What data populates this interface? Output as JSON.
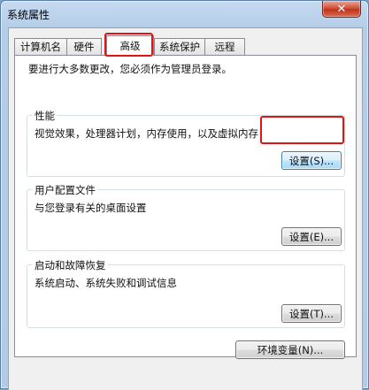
{
  "window": {
    "title": "系统属性",
    "close_symbol": "✕"
  },
  "tabs": [
    {
      "label": "计算机名"
    },
    {
      "label": "硬件"
    },
    {
      "label": "高级"
    },
    {
      "label": "系统保护"
    },
    {
      "label": "远程"
    }
  ],
  "panel": {
    "intro": "要进行大多数更改，您必须作为管理员登录。",
    "performance": {
      "title": "性能",
      "desc": "视觉效果，处理器计划，内存使用，以及虚拟内存",
      "button": "设置(S)..."
    },
    "user_profiles": {
      "title": "用户配置文件",
      "desc": "与您登录有关的桌面设置",
      "button": "设置(E)..."
    },
    "startup_recovery": {
      "title": "启动和故障恢复",
      "desc": "系统启动、系统失败和调试信息",
      "button": "设置(T)..."
    },
    "env_button": "环境变量(N)..."
  }
}
